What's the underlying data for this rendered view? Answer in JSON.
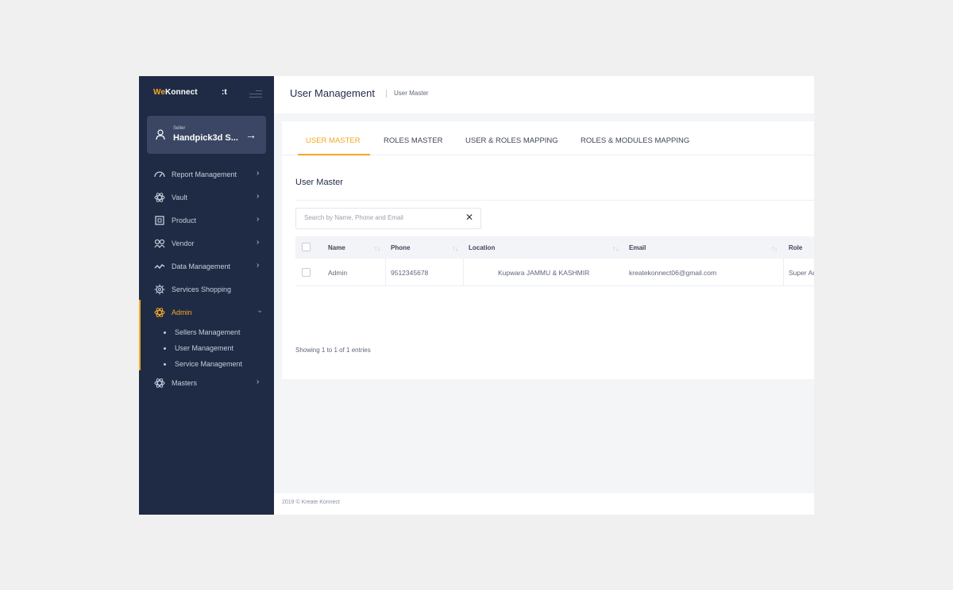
{
  "brand": {
    "we": "We",
    "konnect": "Konnect",
    "extra": ":t"
  },
  "seller": {
    "label": "Seller",
    "name": "Handpick3d S..."
  },
  "nav": [
    {
      "label": "Report Management",
      "icon": "gauge-icon"
    },
    {
      "label": "Vault",
      "icon": "atom-icon"
    },
    {
      "label": "Product",
      "icon": "box-icon"
    },
    {
      "label": "Vendor",
      "icon": "users-icon"
    },
    {
      "label": "Data Management",
      "icon": "chart-line-icon"
    },
    {
      "label": "Services Shopping",
      "icon": "gear-icon"
    },
    {
      "label": "Admin",
      "icon": "atom-icon"
    },
    {
      "label": "Masters",
      "icon": "atom-icon"
    }
  ],
  "admin_sub": [
    "Sellers Management",
    "User Management",
    "Service Management"
  ],
  "header": {
    "title": "User Management",
    "breadcrumb": "User Master"
  },
  "tabs": [
    "USER MASTER",
    "ROLES MASTER",
    "USER & ROLES MAPPING",
    "ROLES & MODULES MAPPING"
  ],
  "section_title": "User Master",
  "search": {
    "placeholder": "Search by Name, Phone and Email",
    "clear": "✕"
  },
  "table": {
    "columns": [
      "Name",
      "Phone",
      "Location",
      "Email",
      "Role"
    ],
    "rows": [
      {
        "name": "Admin",
        "phone": "9512345678",
        "location": "Kupwara JAMMU & KASHMIR",
        "email": "kreatekonnect06@gmail.com",
        "role": "Super Ad"
      }
    ]
  },
  "entries_info": "Showing 1 to 1 of 1 entries",
  "footer": "2019 © Kreate Konnect",
  "colors": {
    "sidebar": "#1f2b45",
    "accent": "#f5a623",
    "card": "#3a4663"
  }
}
